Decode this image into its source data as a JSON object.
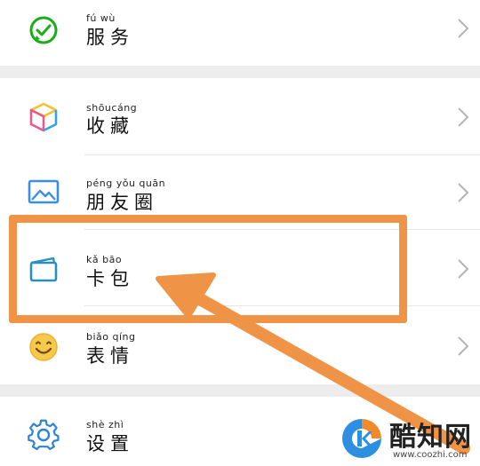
{
  "menu": {
    "items": [
      {
        "pinyin": "fú  wù",
        "label": "服务",
        "icon": "wechat-pay-icon"
      },
      {
        "pinyin": "shōucáng",
        "label": "收藏",
        "icon": "favorites-cube-icon"
      },
      {
        "pinyin": "péng yǒu quān",
        "label": "朋友圈",
        "icon": "moments-image-icon"
      },
      {
        "pinyin": "kǎ  bāo",
        "label": "卡包",
        "icon": "card-wallet-icon"
      },
      {
        "pinyin": "biǎo qíng",
        "label": "表情",
        "icon": "smiley-icon"
      },
      {
        "pinyin": "shè  zhì",
        "label": "设置",
        "icon": "gear-icon"
      }
    ]
  },
  "annotation": {
    "color": "#ef9347",
    "highlighted_item": "卡包"
  },
  "watermark": {
    "name": "酷知网",
    "url": "www.coozhi.com"
  }
}
